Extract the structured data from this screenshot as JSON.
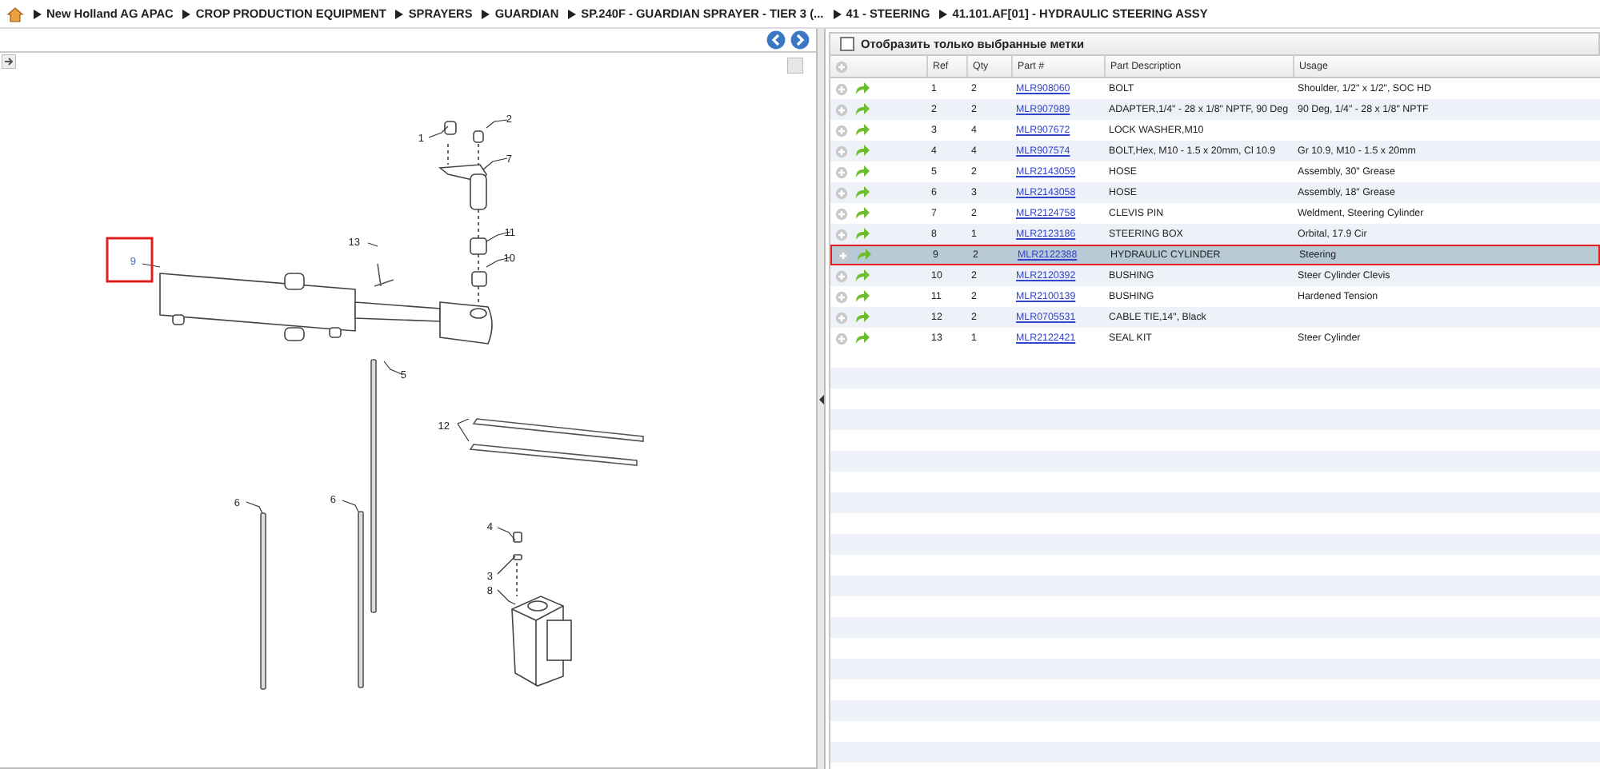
{
  "breadcrumb": [
    "New Holland AG APAC",
    "CROP PRODUCTION EQUIPMENT",
    "SPRAYERS",
    "GUARDIAN",
    "SP.240F - GUARDIAN SPRAYER - TIER 3 (...",
    "41 - STEERING",
    "41.101.AF[01] - HYDRAULIC STEERING ASSY"
  ],
  "diagram": {
    "callouts": [
      {
        "label": "1",
        "selected": false
      },
      {
        "label": "2",
        "selected": false
      },
      {
        "label": "7",
        "selected": false
      },
      {
        "label": "11",
        "selected": false
      },
      {
        "label": "10",
        "selected": false
      },
      {
        "label": "13",
        "selected": false
      },
      {
        "label": "9",
        "selected": true
      },
      {
        "label": "5",
        "selected": false
      },
      {
        "label": "12",
        "selected": false
      },
      {
        "label": "6",
        "selected": false
      },
      {
        "label": "6",
        "selected": false
      },
      {
        "label": "4",
        "selected": false
      },
      {
        "label": "3",
        "selected": false
      },
      {
        "label": "8",
        "selected": false
      }
    ]
  },
  "filter": {
    "label": "Отобразить только выбранные метки",
    "checked": false
  },
  "table": {
    "columns": [
      "Ref",
      "Qty",
      "Part #",
      "Part Description",
      "Usage"
    ],
    "rows": [
      {
        "ref": "1",
        "qty": "2",
        "part": "MLR908060",
        "description": "BOLT",
        "usage": "Shoulder, 1/2\" x 1/2\", SOC HD",
        "selected": false
      },
      {
        "ref": "2",
        "qty": "2",
        "part": "MLR907989",
        "description": "ADAPTER,1/4\" - 28 x 1/8\" NPTF, 90 Deg",
        "usage": "90 Deg, 1/4\" - 28 x 1/8\" NPTF",
        "selected": false
      },
      {
        "ref": "3",
        "qty": "4",
        "part": "MLR907672",
        "description": "LOCK WASHER,M10",
        "selected": false
      },
      {
        "ref": "4",
        "qty": "4",
        "part": "MLR907574",
        "description": "BOLT,Hex, M10 - 1.5 x 20mm, Cl 10.9",
        "usage": "Gr 10.9, M10 - 1.5 x 20mm",
        "selected": false
      },
      {
        "ref": "5",
        "qty": "2",
        "part": "MLR2143059",
        "description": "HOSE",
        "usage": "Assembly, 30\" Grease",
        "selected": false
      },
      {
        "ref": "6",
        "qty": "3",
        "part": "MLR2143058",
        "description": "HOSE",
        "usage": "Assembly, 18\" Grease",
        "selected": false
      },
      {
        "ref": "7",
        "qty": "2",
        "part": "MLR2124758",
        "description": "CLEVIS PIN",
        "usage": "Weldment, Steering Cylinder",
        "selected": false
      },
      {
        "ref": "8",
        "qty": "1",
        "part": "MLR2123186",
        "description": "STEERING BOX",
        "usage": "Orbital, 17.9 Cir",
        "selected": false
      },
      {
        "ref": "9",
        "qty": "2",
        "part": "MLR2122388",
        "description": "HYDRAULIC CYLINDER",
        "usage": "Steering",
        "selected": true
      },
      {
        "ref": "10",
        "qty": "2",
        "part": "MLR2120392",
        "description": "BUSHING",
        "usage": "Steer Cylinder Clevis",
        "selected": false
      },
      {
        "ref": "11",
        "qty": "2",
        "part": "MLR2100139",
        "description": "BUSHING",
        "usage": "Hardened Tension",
        "selected": false
      },
      {
        "ref": "12",
        "qty": "2",
        "part": "MLR0705531",
        "description": "CABLE TIE,14\", Black",
        "selected": false
      },
      {
        "ref": "13",
        "qty": "1",
        "part": "MLR2122421",
        "description": "SEAL KIT",
        "usage": "Steer Cylinder",
        "selected": false
      }
    ]
  }
}
